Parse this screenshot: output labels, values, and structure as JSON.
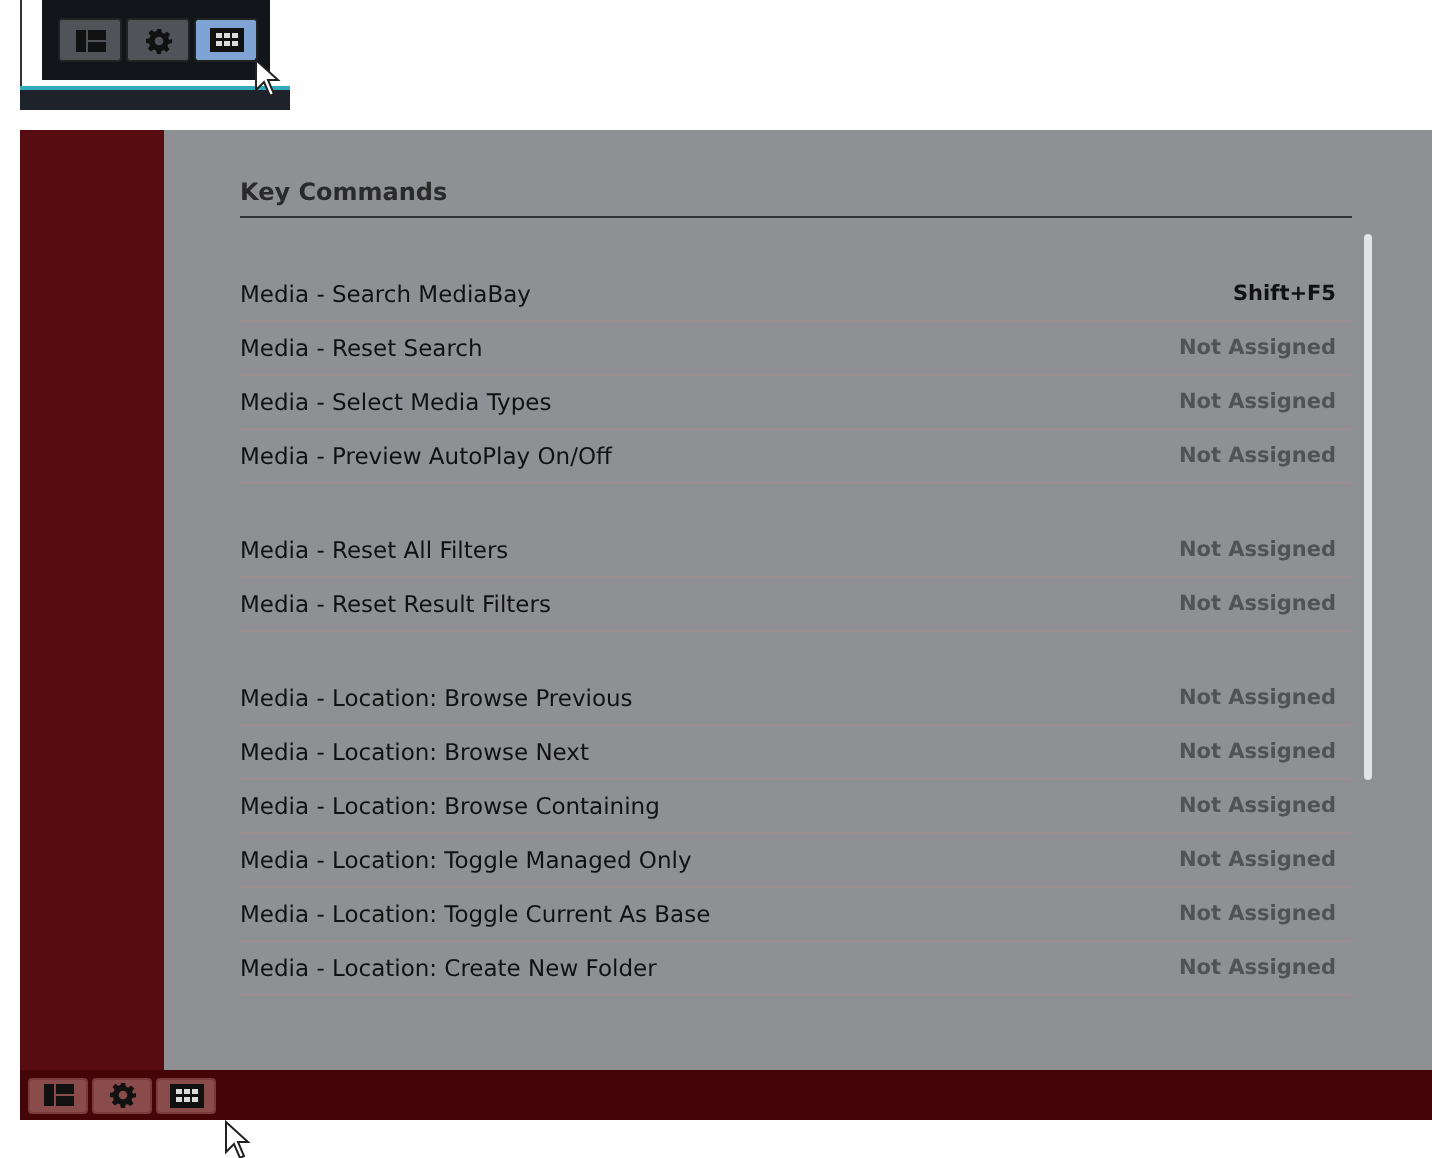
{
  "inset_toolbar": {
    "buttons": [
      {
        "kind": "layout",
        "selected": false
      },
      {
        "kind": "settings",
        "selected": false
      },
      {
        "kind": "keyboard",
        "selected": true
      }
    ]
  },
  "key_commands": {
    "title": "Key Commands",
    "groups": [
      [
        {
          "command": "Media - Search MediaBay",
          "shortcut": "Shift+F5",
          "assigned": true
        },
        {
          "command": "Media - Reset Search",
          "shortcut": "Not Assigned",
          "assigned": false
        },
        {
          "command": "Media - Select Media Types",
          "shortcut": "Not Assigned",
          "assigned": false
        },
        {
          "command": "Media - Preview AutoPlay On/Off",
          "shortcut": "Not Assigned",
          "assigned": false
        }
      ],
      [
        {
          "command": "Media - Reset All Filters",
          "shortcut": "Not Assigned",
          "assigned": false
        },
        {
          "command": "Media - Reset Result Filters",
          "shortcut": "Not Assigned",
          "assigned": false
        }
      ],
      [
        {
          "command": "Media - Location: Browse Previous",
          "shortcut": "Not Assigned",
          "assigned": false
        },
        {
          "command": "Media - Location: Browse Next",
          "shortcut": "Not Assigned",
          "assigned": false
        },
        {
          "command": "Media - Location: Browse Containing",
          "shortcut": "Not Assigned",
          "assigned": false
        },
        {
          "command": "Media - Location: Toggle Managed Only",
          "shortcut": "Not Assigned",
          "assigned": false
        },
        {
          "command": "Media - Location: Toggle Current As Base",
          "shortcut": "Not Assigned",
          "assigned": false
        },
        {
          "command": "Media - Location: Create New Folder",
          "shortcut": "Not Assigned",
          "assigned": false
        }
      ]
    ]
  },
  "bottom_toolbar": {
    "buttons": [
      {
        "kind": "layout",
        "selected": false
      },
      {
        "kind": "settings",
        "selected": false
      },
      {
        "kind": "keyboard",
        "selected": false
      }
    ]
  }
}
